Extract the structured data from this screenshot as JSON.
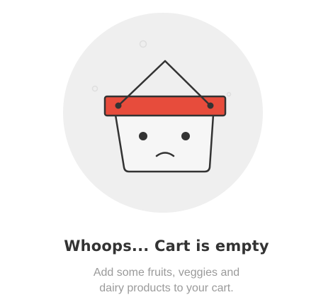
{
  "empty_state": {
    "title": "Whoops... Cart is empty",
    "message_line_1": "Add some fruits, veggies and",
    "message_line_2": "dairy products to your cart."
  },
  "illustration": {
    "icon": "sad-shopping-basket-icon",
    "colors": {
      "circle": "#efefef",
      "rim": "#e74c3c",
      "outline": "#333333",
      "basket": "#f6f6f6",
      "text_title": "#333333",
      "text_message": "#9a9a9a"
    }
  }
}
